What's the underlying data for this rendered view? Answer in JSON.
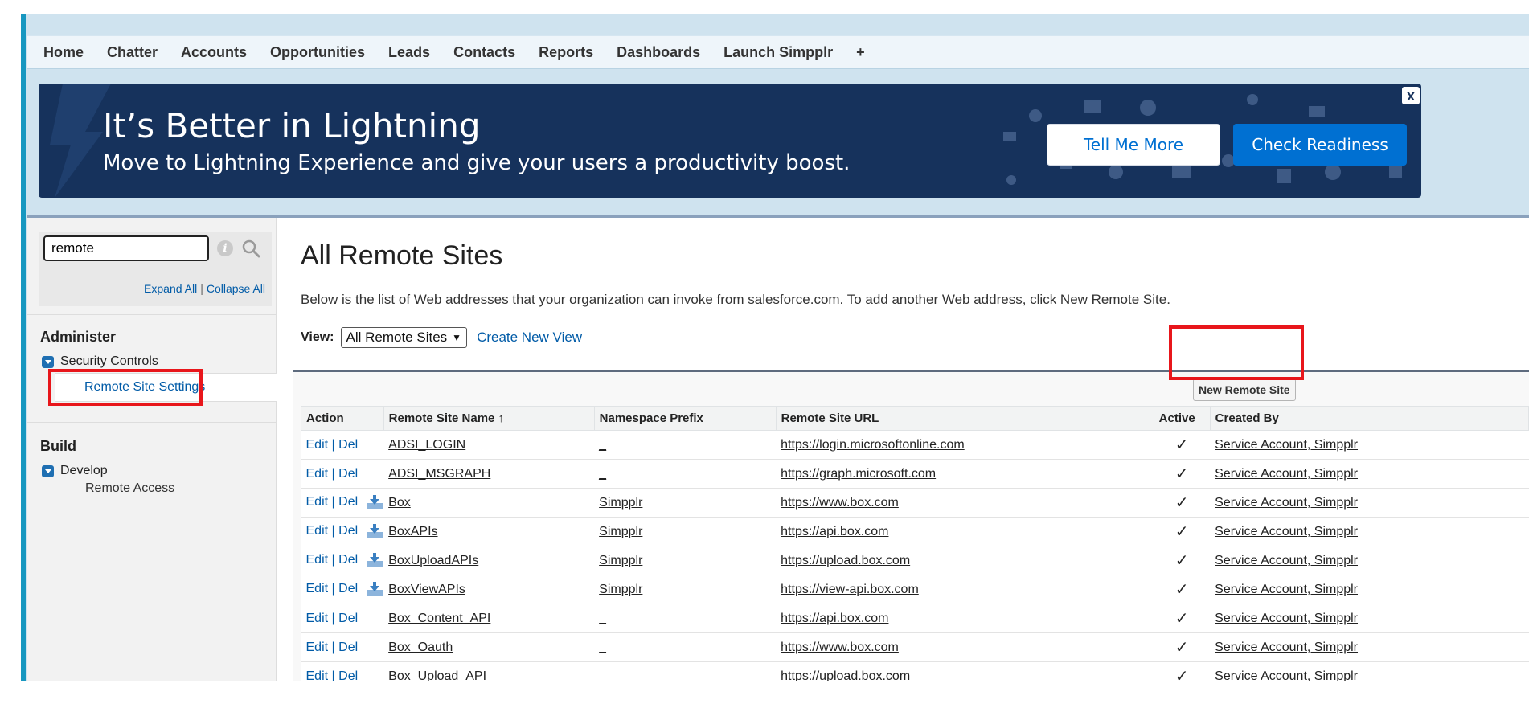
{
  "nav": {
    "items": [
      "Home",
      "Chatter",
      "Accounts",
      "Opportunities",
      "Leads",
      "Contacts",
      "Reports",
      "Dashboards",
      "Launch Simpplr"
    ],
    "plus": "+"
  },
  "banner": {
    "title": "It’s Better in Lightning",
    "subtitle": "Move to Lightning Experience and give your users a productivity boost.",
    "tell_more": "Tell Me More",
    "check_readiness": "Check Readiness",
    "close": "x"
  },
  "sidebar": {
    "search_value": "remote",
    "expand_all": "Expand All",
    "sep": "|",
    "collapse_all": "Collapse All",
    "sections": [
      {
        "heading": "Administer",
        "group": "Security Controls",
        "item": "Remote Site Settings"
      },
      {
        "heading": "Build",
        "group": "Develop",
        "item": "Remote Access"
      }
    ]
  },
  "main": {
    "title": "All Remote Sites",
    "description": "Below is the list of Web addresses that your organization can invoke from salesforce.com. To add another Web address, click New Remote Site.",
    "view_label": "View:",
    "view_selected": "All Remote Sites",
    "create_view": "Create New View",
    "new_remote_site": "New Remote Site"
  },
  "table": {
    "headers": {
      "action": "Action",
      "name": "Remote Site Name ↑",
      "namespace": "Namespace Prefix",
      "url": "Remote Site URL",
      "active": "Active",
      "created_by": "Created By"
    },
    "edit": "Edit",
    "sep": "|",
    "del": "Del",
    "rows": [
      {
        "name": "ADSI_LOGIN",
        "namespace": "_",
        "url": "https://login.microsoftonline.com",
        "active": "✓",
        "created_by": "Service Account, Simpplr",
        "managed": false
      },
      {
        "name": "ADSI_MSGRAPH",
        "namespace": "_",
        "url": "https://graph.microsoft.com",
        "active": "✓",
        "created_by": "Service Account, Simpplr",
        "managed": false
      },
      {
        "name": "Box",
        "namespace": "Simpplr",
        "url": "https://www.box.com",
        "active": "✓",
        "created_by": "Service Account, Simpplr",
        "managed": true
      },
      {
        "name": "BoxAPIs",
        "namespace": "Simpplr",
        "url": "https://api.box.com",
        "active": "✓",
        "created_by": "Service Account, Simpplr",
        "managed": true
      },
      {
        "name": "BoxUploadAPIs",
        "namespace": "Simpplr",
        "url": "https://upload.box.com",
        "active": "✓",
        "created_by": "Service Account, Simpplr",
        "managed": true
      },
      {
        "name": "BoxViewAPIs",
        "namespace": "Simpplr",
        "url": "https://view-api.box.com",
        "active": "✓",
        "created_by": "Service Account, Simpplr",
        "managed": true
      },
      {
        "name": "Box_Content_API",
        "namespace": "_",
        "url": "https://api.box.com",
        "active": "✓",
        "created_by": "Service Account, Simpplr",
        "managed": false
      },
      {
        "name": "Box_Oauth",
        "namespace": "_",
        "url": "https://www.box.com",
        "active": "✓",
        "created_by": "Service Account, Simpplr",
        "managed": false
      },
      {
        "name": "Box_Upload_API",
        "namespace": "_",
        "url": "https://upload.box.com",
        "active": "✓",
        "created_by": "Service Account, Simpplr",
        "managed": false
      }
    ]
  },
  "colors": {
    "banner_bg": "#16325c",
    "accent_blue": "#0070d2",
    "link_blue": "#015ba7",
    "highlight_red": "#e8161b"
  }
}
